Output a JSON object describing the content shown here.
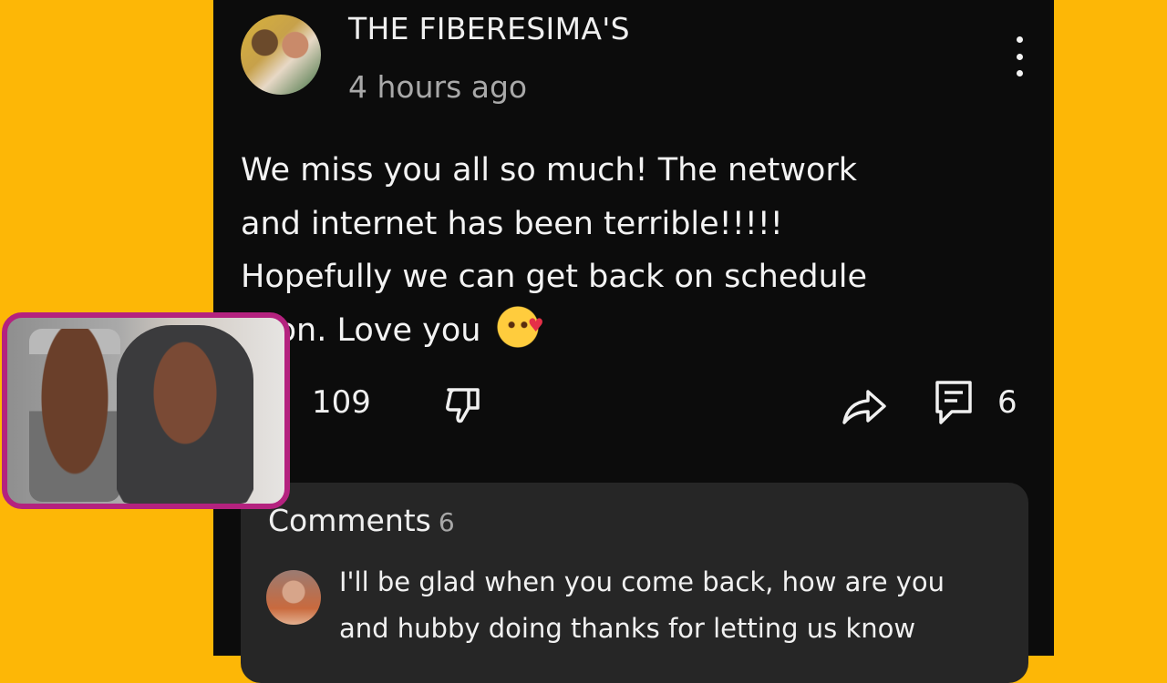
{
  "post": {
    "channel_name": "THE FIBERESIMA'S",
    "timestamp": "4 hours ago",
    "text_lines": [
      "We miss you all so much! The network",
      "and internet has been terrible!!!!!",
      "Hopefully we can get back on schedule",
      "soon. Love you"
    ],
    "emoji": "smiling-face-with-hearts"
  },
  "actions": {
    "like_count": "109",
    "comment_count": "6"
  },
  "comments": {
    "header": "Comments",
    "count": "6",
    "first_comment_lines": [
      "I'll be glad when you come back, how are you",
      "and hubby doing thanks for letting us know"
    ]
  },
  "icons": [
    "kebab-menu-icon",
    "thumbs-up-icon",
    "thumbs-down-icon",
    "share-icon",
    "comment-icon"
  ],
  "colors": {
    "background": "#FDB706",
    "panel": "#0c0c0c",
    "comments_box": "#262626",
    "pip_border": "#b4227f"
  }
}
